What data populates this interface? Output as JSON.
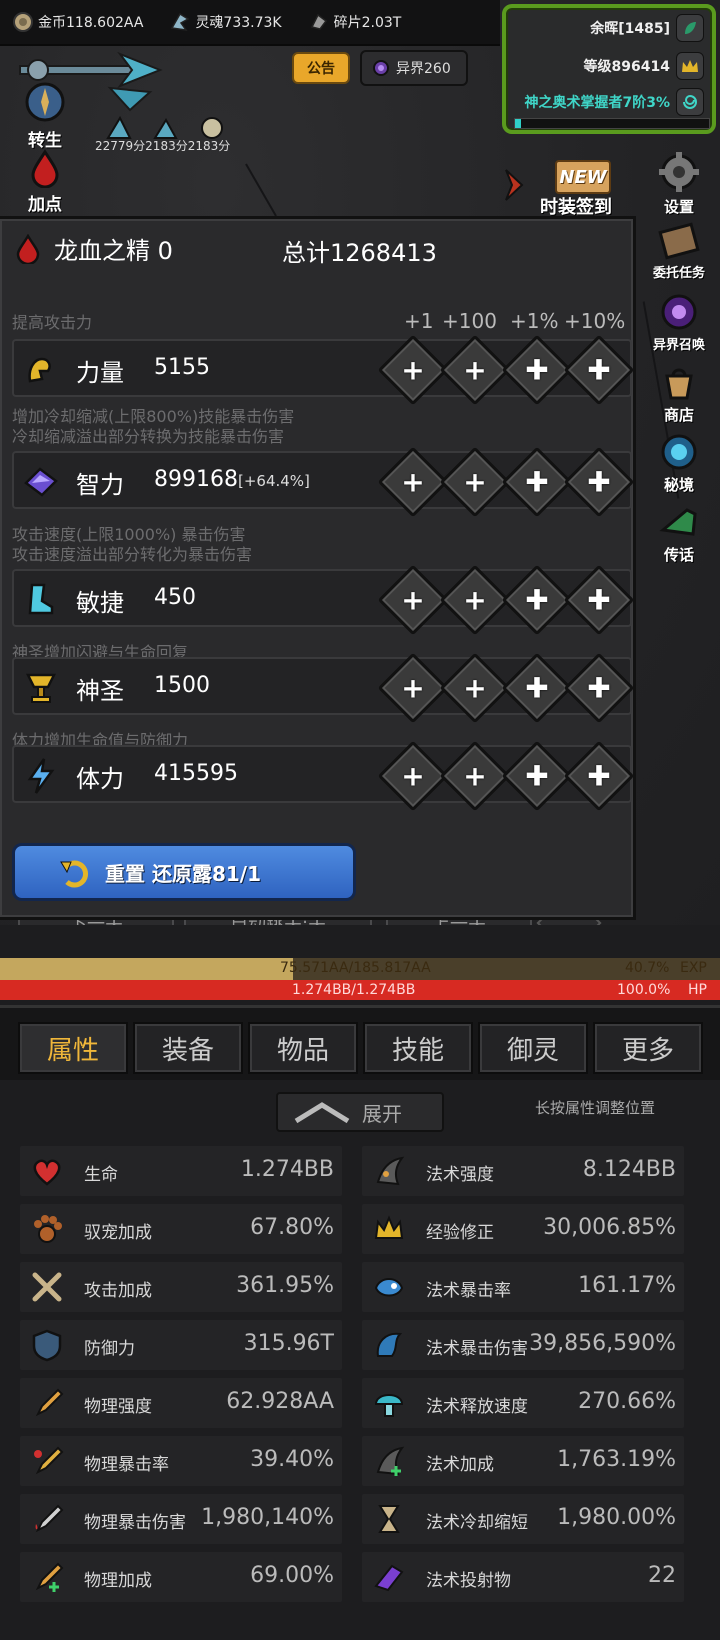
{
  "currency": {
    "gold": "金币118.602AA",
    "soul": "灵魂733.73K",
    "shard": "碎片2.03T"
  },
  "left_buttons": {
    "rebirth": "转生",
    "addpoint": "加点"
  },
  "notice_label": "公告",
  "realm_label": "异界260",
  "level_box": {
    "afterglow": "余晖[1485]",
    "level": "等级896414",
    "godskill": "神之奥术掌握者7阶3%",
    "godskill_progress": 0.03
  },
  "scores": "22779分2183分2183分",
  "right_buttons": {
    "settings": "设置",
    "commission": "委托任务",
    "summon": "异界召唤",
    "shop": "商店",
    "secret": "秘境",
    "transfer": "传话"
  },
  "new_badge": "NEW",
  "fashion_signin": "时装签到",
  "panel": {
    "resource": "龙血之精 0",
    "total": "总计1268413",
    "columns": [
      "+1",
      "+100",
      "+1%",
      "+10%"
    ],
    "stats": [
      {
        "hint": "提高攻击力",
        "name": "力量",
        "value": "5155",
        "extra": ""
      },
      {
        "hint": "增加冷却缩减(上限800%)技能暴击伤害\n冷却缩减溢出部分转换为技能暴击伤害",
        "name": "智力",
        "value": "899168",
        "extra": "[+64.4%]"
      },
      {
        "hint": "攻击速度(上限1000%) 暴击伤害\n攻击速度溢出部分转化为暴击伤害",
        "name": "敏捷",
        "value": "450",
        "extra": ""
      },
      {
        "hint": "神圣增加闪避与生命回复",
        "name": "神圣",
        "value": "1500",
        "extra": ""
      },
      {
        "hint": "体力增加生命值与防御力",
        "name": "体力",
        "value": "415595",
        "extra": ""
      }
    ],
    "reset_label": "重置 还原露81/1"
  },
  "battle_buttons": {
    "next": "下一关",
    "auto": "自动跳关:关",
    "prev": "上一关"
  },
  "exp": {
    "text": "75.571AA/185.817AA",
    "percent": "40.7%",
    "label": "EXP",
    "fraction": 0.407
  },
  "hp": {
    "text": "1.274BB/1.274BB",
    "percent": "100.0%",
    "label": "HP",
    "fraction": 1.0
  },
  "tabs": [
    "属性",
    "装备",
    "物品",
    "技能",
    "御灵",
    "更多"
  ],
  "expand_label": "展开",
  "longpress_hint": "长按属性调整位置",
  "attributes_left": [
    {
      "name": "生命",
      "value": "1.274BB",
      "icon": "heart-icon"
    },
    {
      "name": "驭宠加成",
      "value": "67.80%",
      "icon": "paw-icon"
    },
    {
      "name": "攻击加成",
      "value": "361.95%",
      "icon": "crossed-swords-icon"
    },
    {
      "name": "防御力",
      "value": "315.96T",
      "icon": "shield-icon"
    },
    {
      "name": "物理强度",
      "value": "62.928AA",
      "icon": "sword-icon"
    },
    {
      "name": "物理暴击率",
      "value": "39.40%",
      "icon": "crit-sword-icon"
    },
    {
      "name": "物理暴击伤害",
      "value": "1,980,140%",
      "icon": "blood-sword-icon"
    },
    {
      "name": "物理加成",
      "value": "69.00%",
      "icon": "sword-plus-icon"
    }
  ],
  "attributes_right": [
    {
      "name": "法术强度",
      "value": "8.124BB",
      "icon": "magic-claw-icon"
    },
    {
      "name": "经验修正",
      "value": "30,006.85%",
      "icon": "crown-icon"
    },
    {
      "name": "法术暴击率",
      "value": "161.17%",
      "icon": "blue-beast-icon"
    },
    {
      "name": "法术暴击伤害",
      "value": "39,856,590%",
      "icon": "blue-dragon-icon"
    },
    {
      "name": "法术释放速度",
      "value": "270.66%",
      "icon": "mushroom-icon"
    },
    {
      "name": "法术加成",
      "value": "1,763.19%",
      "icon": "magic-plus-icon"
    },
    {
      "name": "法术冷却缩短",
      "value": "1,980.00%",
      "icon": "hourglass-icon"
    },
    {
      "name": "法术投射物",
      "value": "22",
      "icon": "purple-missile-icon"
    }
  ]
}
